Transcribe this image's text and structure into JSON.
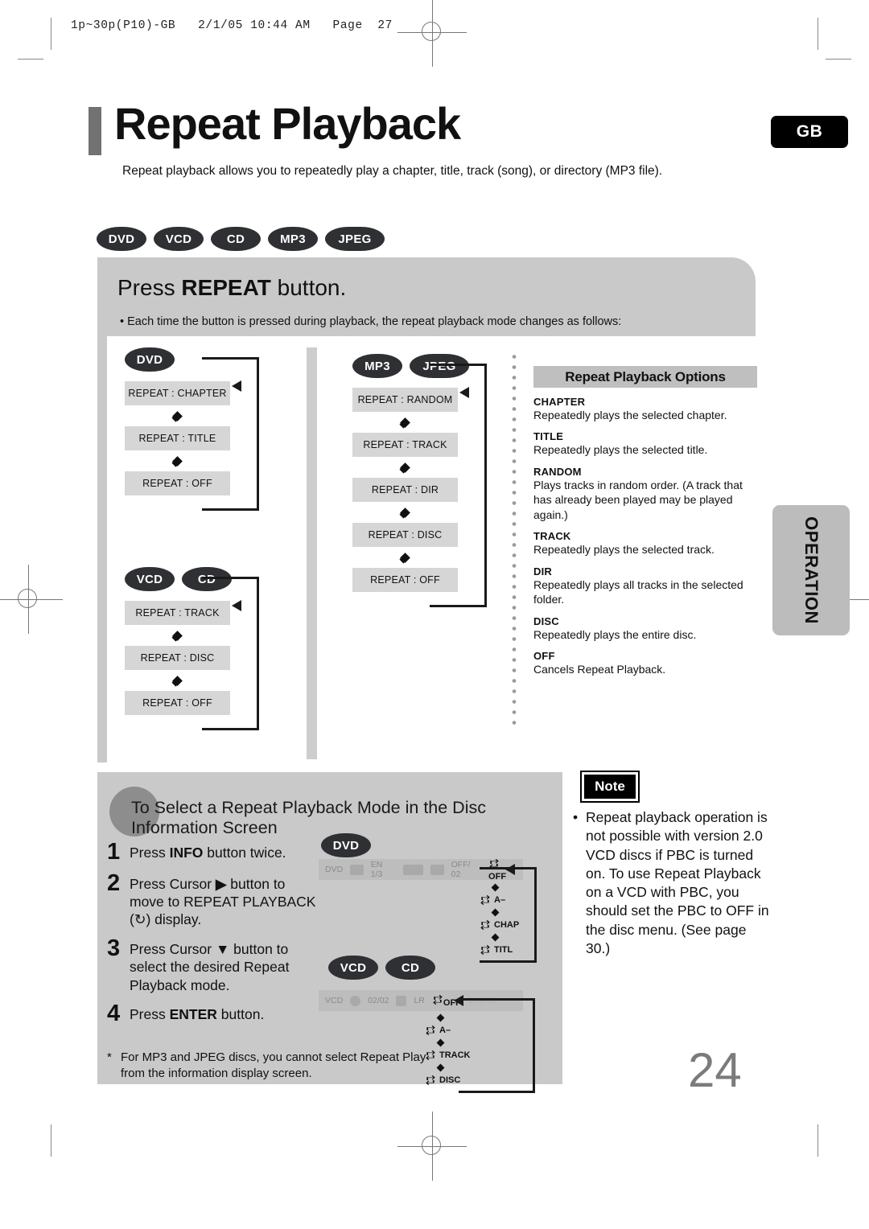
{
  "print_header": "1p~30p(P10)-GB   2/1/05 10:44 AM   Page  27",
  "header": {
    "title": "Repeat Playback",
    "region_badge": "GB",
    "subtitle": "Repeat playback allows you to repeatedly play a chapter, title, track (song), or directory (MP3 file)."
  },
  "disc_pills": [
    "DVD",
    "VCD",
    "CD",
    "MP3",
    "JPEG"
  ],
  "instruction_panel": {
    "heading_before": "Press ",
    "heading_bold": "REPEAT",
    "heading_after": " button.",
    "bullet": "• Each time the button is pressed during playback, the repeat playback mode changes as follows:"
  },
  "flowcharts": [
    {
      "pills": [
        "DVD"
      ],
      "steps": [
        "REPEAT : CHAPTER",
        "REPEAT : TITLE",
        "REPEAT : OFF"
      ]
    },
    {
      "pills": [
        "VCD",
        "CD"
      ],
      "steps": [
        "REPEAT : TRACK",
        "REPEAT : DISC",
        "REPEAT : OFF"
      ]
    },
    {
      "pills": [
        "MP3",
        "JPEG"
      ],
      "steps": [
        "REPEAT : RANDOM",
        "REPEAT : TRACK",
        "REPEAT : DIR",
        "REPEAT : DISC",
        "REPEAT : OFF"
      ]
    }
  ],
  "options": {
    "title": "Repeat Playback Options",
    "items": [
      {
        "term": "CHAPTER",
        "desc": "Repeatedly plays the selected chapter."
      },
      {
        "term": "TITLE",
        "desc": "Repeatedly plays the selected title."
      },
      {
        "term": "RANDOM",
        "desc": "Plays tracks in random order.\n(A track that has already been played may be played again.)"
      },
      {
        "term": "TRACK",
        "desc": "Repeatedly plays the selected track."
      },
      {
        "term": "DIR",
        "desc": "Repeatedly plays all tracks in the selected folder."
      },
      {
        "term": "DISC",
        "desc": "Repeatedly plays the entire disc."
      },
      {
        "term": "OFF",
        "desc": "Cancels Repeat Playback."
      }
    ]
  },
  "side_tab": "OPERATION",
  "bottom_section": {
    "heading": "To Select a Repeat Playback Mode in the Disc Information Screen",
    "steps": [
      {
        "no": "1",
        "before": "Press ",
        "bold": "INFO",
        "after": " button twice."
      },
      {
        "no": "2",
        "before": "Press Cursor ",
        "bold": "▶",
        "after": " button to move to REPEAT PLAYBACK (↻) display."
      },
      {
        "no": "3",
        "before": "Press Cursor ",
        "bold": "▼",
        "after": " button to select the desired Repeat Playback mode."
      },
      {
        "no": "4",
        "before": "Press ",
        "bold": "ENTER",
        "after": " button."
      }
    ],
    "footnote_star": "*",
    "footnote": "For MP3 and JPEG discs, you cannot select Repeat Play from the information display screen."
  },
  "osd_dvd": {
    "pills": [
      "DVD"
    ],
    "bar": [
      "DVD",
      "EN 1/3",
      "OFF/ 02"
    ],
    "bar_active": "OFF",
    "cycle": [
      "A–",
      "CHAP",
      "TITL"
    ]
  },
  "osd_vcd": {
    "pills": [
      "VCD",
      "CD"
    ],
    "bar": [
      "VCD",
      "02/02",
      "LR"
    ],
    "bar_active": "OFF",
    "bar_time": "0:00:00",
    "cycle": [
      "A–",
      "TRACK",
      "DISC"
    ]
  },
  "note": {
    "label": "Note",
    "bullet": "•",
    "text": "Repeat playback operation is not possible with version 2.0 VCD discs if PBC is turned on. To use Repeat Playback on a VCD with PBC, you should set the PBC to OFF in the disc menu. (See page 30.)"
  },
  "page_number": "24"
}
